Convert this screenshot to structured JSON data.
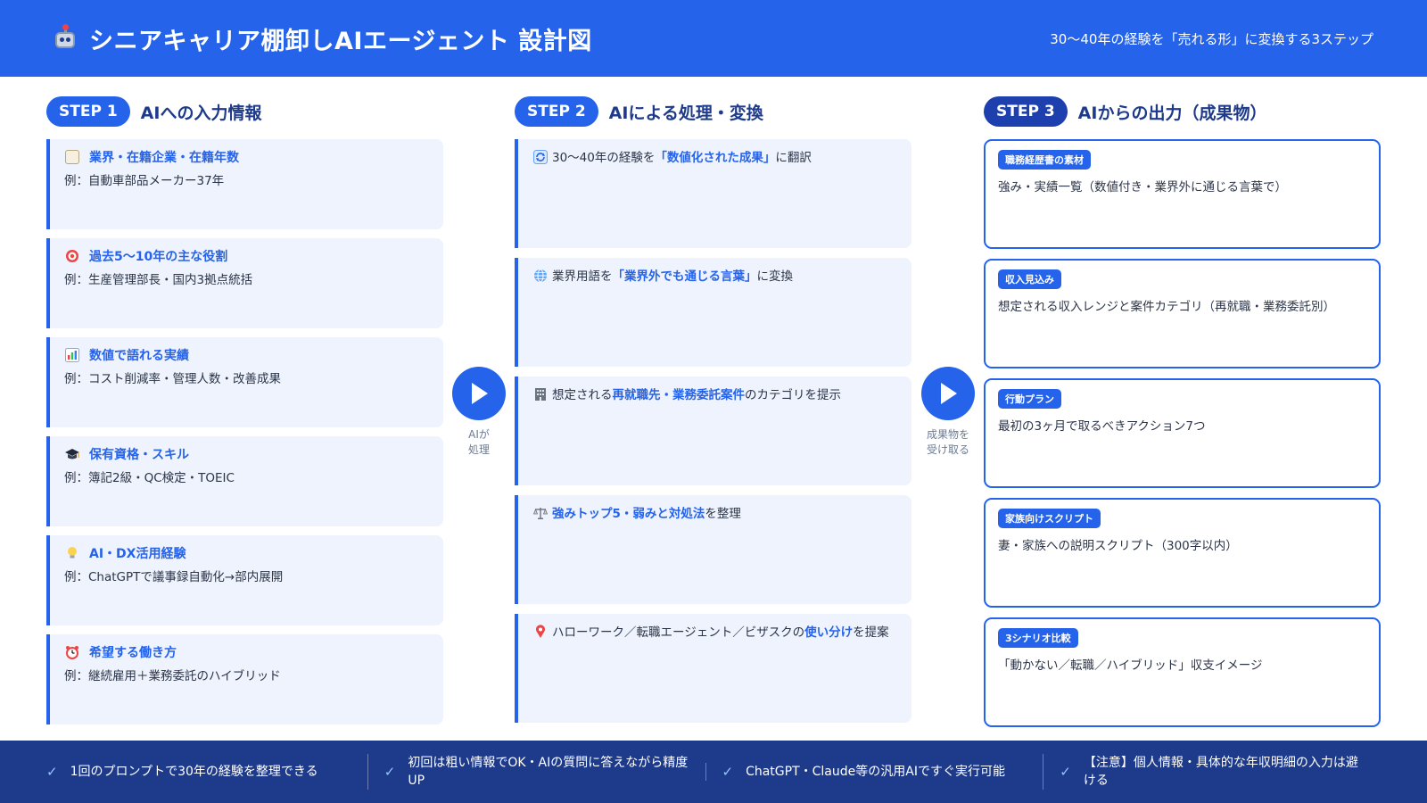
{
  "header": {
    "title": "シニアキャリア棚卸しAIエージェント 設計図",
    "subtitle": "30〜40年の経験を「売れる形」に変換する3ステップ",
    "icon": "robot-icon"
  },
  "step1": {
    "badge": "STEP 1",
    "title": "AIへの入力情報",
    "items": [
      {
        "icon": "clipboard-icon",
        "title": "業界・在籍企業・在籍年数",
        "desc": "例：自動車部品メーカー37年"
      },
      {
        "icon": "target-icon",
        "title": "過去5〜10年の主な役割",
        "desc": "例：生産管理部長・国内3拠点統括"
      },
      {
        "icon": "bar-chart-icon",
        "title": "数値で語れる実績",
        "desc": "例：コスト削減率・管理人数・改善成果"
      },
      {
        "icon": "graduation-cap-icon",
        "title": "保有資格・スキル",
        "desc": "例：簿記2級・QC検定・TOEIC"
      },
      {
        "icon": "lightbulb-icon",
        "title": "AI・DX活用経験",
        "desc": "例：ChatGPTで議事録自動化→部内展開"
      },
      {
        "icon": "alarm-clock-icon",
        "title": "希望する働き方",
        "desc": "例：継続雇用＋業務委託のハイブリッド"
      }
    ]
  },
  "step2": {
    "badge": "STEP 2",
    "title": "AIによる処理・変換",
    "items": [
      {
        "icon": "refresh-icon",
        "pre": "30〜40年の経験を",
        "hl": "「数値化された成果」",
        "post": "に翻訳"
      },
      {
        "icon": "globe-icon",
        "pre": "業界用語を",
        "hl": "「業界外でも通じる言葉」",
        "post": "に変換"
      },
      {
        "icon": "building-icon",
        "pre": "想定される",
        "hl": "再就職先・業務委託案件",
        "post": "のカテゴリを提示"
      },
      {
        "icon": "scales-icon",
        "pre": "",
        "hl": "強みトップ5・弱みと対処法",
        "post": "を整理"
      },
      {
        "icon": "pin-icon",
        "pre": "ハローワーク／転職エージェント／ビザスクの",
        "hl": "使い分け",
        "post": "を提案"
      }
    ]
  },
  "step3": {
    "badge": "STEP 3",
    "title": "AIからの出力（成果物）",
    "items": [
      {
        "label": "職務経歴書の素材",
        "desc": "強み・実績一覧（数値付き・業界外に通じる言葉で）"
      },
      {
        "label": "収入見込み",
        "desc": "想定される収入レンジと案件カテゴリ（再就職・業務委託別）"
      },
      {
        "label": "行動プラン",
        "desc": "最初の3ヶ月で取るべきアクション7つ"
      },
      {
        "label": "家族向けスクリプト",
        "desc": "妻・家族への説明スクリプト（300字以内）"
      },
      {
        "label": "3シナリオ比較",
        "desc": "「動かない／転職／ハイブリッド」収支イメージ"
      }
    ]
  },
  "arrows": {
    "a1_line1": "AIが",
    "a1_line2": "処理",
    "a2_line1": "成果物を",
    "a2_line2": "受け取る"
  },
  "footer": {
    "items": [
      "1回のプロンプトで30年の経験を整理できる",
      "初回は粗い情報でOK・AIの質問に答えながら精度UP",
      "ChatGPT・Claude等の汎用AIですぐ実行可能",
      "【注意】個人情報・具体的な年収明細の入力は避ける"
    ]
  },
  "colors": {
    "primary": "#2563eb",
    "dark": "#1e3a8a",
    "card_bg": "#eef3fd"
  }
}
